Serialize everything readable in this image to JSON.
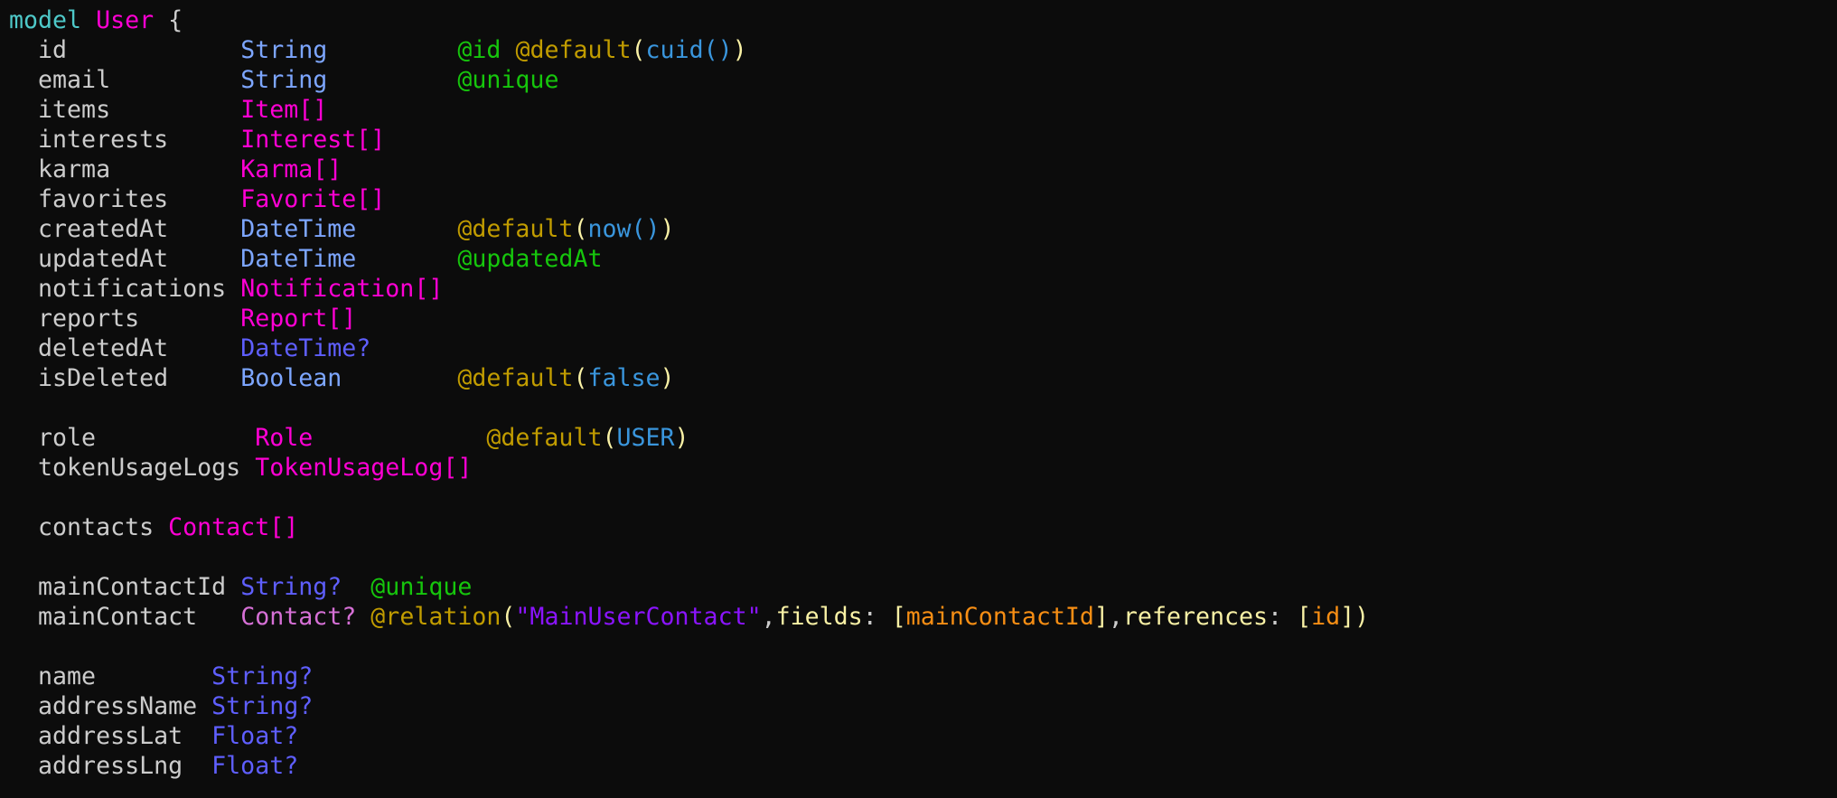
{
  "editor": {
    "language": "prisma",
    "colors": {
      "background": "#0c0c0c",
      "keyword": "#4ec9c9",
      "model_name": "#ff00d4",
      "field_name": "#cccccc",
      "scalar_type": "#7da6ff",
      "optional_type": "#5f5fff",
      "optional_relation_type": "#d670d6",
      "attribute_green": "#16c60c",
      "attribute_gold": "#c19c00",
      "bracket": "#f9f1a5",
      "function": "#3a96dd",
      "string": "#8b14ff",
      "reference": "#f78e14"
    },
    "lines": [
      [
        {
          "t": "model",
          "c": "kw"
        },
        {
          "t": " ",
          "c": "punct"
        },
        {
          "t": "User",
          "c": "model"
        },
        {
          "t": " {",
          "c": "punct"
        }
      ],
      [
        {
          "t": "  id            ",
          "c": "field"
        },
        {
          "t": "String",
          "c": "scalar"
        },
        {
          "t": "         ",
          "c": "punct"
        },
        {
          "t": "@id",
          "c": "attr-grn"
        },
        {
          "t": " ",
          "c": "punct"
        },
        {
          "t": "@default",
          "c": "attr-gold"
        },
        {
          "t": "(",
          "c": "paren"
        },
        {
          "t": "cuid()",
          "c": "fn"
        },
        {
          "t": ")",
          "c": "paren"
        }
      ],
      [
        {
          "t": "  email         ",
          "c": "field"
        },
        {
          "t": "String",
          "c": "scalar"
        },
        {
          "t": "         ",
          "c": "punct"
        },
        {
          "t": "@unique",
          "c": "attr-grn"
        }
      ],
      [
        {
          "t": "  items         ",
          "c": "field"
        },
        {
          "t": "Item[]",
          "c": "relarr"
        }
      ],
      [
        {
          "t": "  interests     ",
          "c": "field"
        },
        {
          "t": "Interest[]",
          "c": "relarr"
        }
      ],
      [
        {
          "t": "  karma         ",
          "c": "field"
        },
        {
          "t": "Karma[]",
          "c": "relarr"
        }
      ],
      [
        {
          "t": "  favorites     ",
          "c": "field"
        },
        {
          "t": "Favorite[]",
          "c": "relarr"
        }
      ],
      [
        {
          "t": "  createdAt     ",
          "c": "field"
        },
        {
          "t": "DateTime",
          "c": "scalar"
        },
        {
          "t": "       ",
          "c": "punct"
        },
        {
          "t": "@default",
          "c": "attr-gold"
        },
        {
          "t": "(",
          "c": "paren"
        },
        {
          "t": "now()",
          "c": "fn"
        },
        {
          "t": ")",
          "c": "paren"
        }
      ],
      [
        {
          "t": "  updatedAt     ",
          "c": "field"
        },
        {
          "t": "DateTime",
          "c": "scalar"
        },
        {
          "t": "       ",
          "c": "punct"
        },
        {
          "t": "@updatedAt",
          "c": "attr-grn"
        }
      ],
      [
        {
          "t": "  notifications ",
          "c": "field"
        },
        {
          "t": "Notification[]",
          "c": "relarr"
        }
      ],
      [
        {
          "t": "  reports       ",
          "c": "field"
        },
        {
          "t": "Report[]",
          "c": "relarr"
        }
      ],
      [
        {
          "t": "  deletedAt     ",
          "c": "field"
        },
        {
          "t": "DateTime?",
          "c": "optional"
        }
      ],
      [
        {
          "t": "  isDeleted     ",
          "c": "field"
        },
        {
          "t": "Boolean",
          "c": "scalar"
        },
        {
          "t": "        ",
          "c": "punct"
        },
        {
          "t": "@default",
          "c": "attr-gold"
        },
        {
          "t": "(",
          "c": "paren"
        },
        {
          "t": "false",
          "c": "fn"
        },
        {
          "t": ")",
          "c": "paren"
        }
      ],
      [],
      [
        {
          "t": "  role           ",
          "c": "field"
        },
        {
          "t": "Role",
          "c": "relarr"
        },
        {
          "t": "            ",
          "c": "punct"
        },
        {
          "t": "@default",
          "c": "attr-gold"
        },
        {
          "t": "(",
          "c": "paren"
        },
        {
          "t": "USER",
          "c": "fn"
        },
        {
          "t": ")",
          "c": "paren"
        }
      ],
      [
        {
          "t": "  tokenUsageLogs ",
          "c": "field"
        },
        {
          "t": "TokenUsageLog[]",
          "c": "relarr"
        }
      ],
      [],
      [
        {
          "t": "  contacts ",
          "c": "field"
        },
        {
          "t": "Contact[]",
          "c": "relarr"
        }
      ],
      [],
      [
        {
          "t": "  mainContactId ",
          "c": "field"
        },
        {
          "t": "String?",
          "c": "optional"
        },
        {
          "t": "  ",
          "c": "punct"
        },
        {
          "t": "@unique",
          "c": "attr-grn"
        }
      ],
      [
        {
          "t": "  mainContact   ",
          "c": "field"
        },
        {
          "t": "Contact?",
          "c": "relopt"
        },
        {
          "t": " ",
          "c": "punct"
        },
        {
          "t": "@relation",
          "c": "attr-gold"
        },
        {
          "t": "(",
          "c": "paren"
        },
        {
          "t": "\"MainUserContact\"",
          "c": "string"
        },
        {
          "t": ",",
          "c": "punct"
        },
        {
          "t": "fields",
          "c": "arg"
        },
        {
          "t": ": ",
          "c": "punct"
        },
        {
          "t": "[",
          "c": "paren"
        },
        {
          "t": "mainContactId",
          "c": "ref"
        },
        {
          "t": "]",
          "c": "paren"
        },
        {
          "t": ",",
          "c": "punct"
        },
        {
          "t": "references",
          "c": "arg"
        },
        {
          "t": ": ",
          "c": "punct"
        },
        {
          "t": "[",
          "c": "paren"
        },
        {
          "t": "id",
          "c": "ref"
        },
        {
          "t": "])",
          "c": "paren"
        }
      ],
      [],
      [
        {
          "t": "  name        ",
          "c": "field"
        },
        {
          "t": "String?",
          "c": "optional"
        }
      ],
      [
        {
          "t": "  addressName ",
          "c": "field"
        },
        {
          "t": "String?",
          "c": "optional"
        }
      ],
      [
        {
          "t": "  addressLat  ",
          "c": "field"
        },
        {
          "t": "Float?",
          "c": "optional"
        }
      ],
      [
        {
          "t": "  addressLng  ",
          "c": "field"
        },
        {
          "t": "Float?",
          "c": "optional"
        }
      ]
    ]
  }
}
